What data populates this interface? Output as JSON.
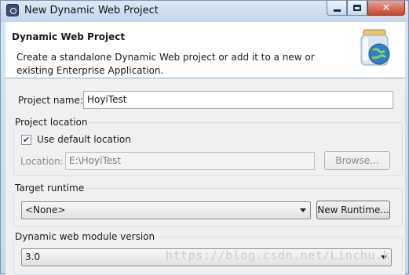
{
  "window": {
    "title": "New Dynamic Web Project",
    "controls": {
      "minimize": "minimize-icon",
      "maximize": "maximize-icon",
      "close": "close-icon"
    }
  },
  "banner": {
    "title": "Dynamic Web Project",
    "description": "Create a standalone Dynamic Web project or add it to a new or existing Enterprise Application.",
    "icon": "web-project-jar-icon"
  },
  "project_name": {
    "label": "Project name:",
    "value": "HoyiTest"
  },
  "project_location": {
    "group_title": "Project location",
    "use_default_label": "Use default location",
    "use_default_checked": true,
    "location_label": "Location:",
    "location_value": "E:\\HoyiTest",
    "browse_label": "Browse..."
  },
  "target_runtime": {
    "group_title": "Target runtime",
    "selected": "<None>",
    "new_runtime_label": "New Runtime..."
  },
  "module_version": {
    "group_title": "Dynamic web module version",
    "selected": "3.0"
  },
  "watermark": "https://blog.csdn.net/Linchu.k"
}
